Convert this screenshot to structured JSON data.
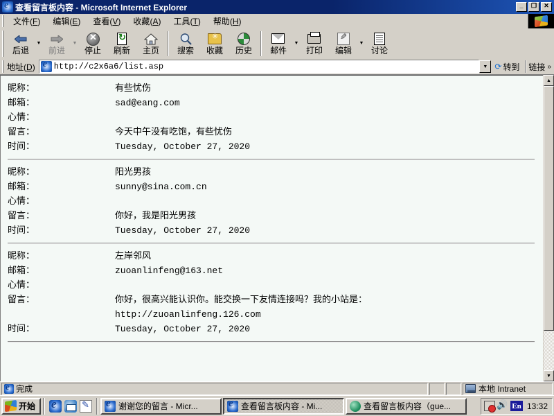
{
  "window": {
    "title": "查看留言板内容 - Microsoft Internet Explorer",
    "minimize_label": "_",
    "restore_label": "❐",
    "close_label": "✕"
  },
  "menubar": [
    {
      "label": "文件",
      "accel": "F"
    },
    {
      "label": "编辑",
      "accel": "E"
    },
    {
      "label": "查看",
      "accel": "V"
    },
    {
      "label": "收藏",
      "accel": "A"
    },
    {
      "label": "工具",
      "accel": "T"
    },
    {
      "label": "帮助",
      "accel": "H"
    }
  ],
  "toolbar": {
    "back": "后退",
    "forward": "前进",
    "stop": "停止",
    "refresh": "刷新",
    "home": "主页",
    "search": "搜索",
    "favorites": "收藏",
    "history": "历史",
    "mail": "邮件",
    "print": "打印",
    "edit": "编辑",
    "discuss": "讨论"
  },
  "address": {
    "label": "地址",
    "accel": "D",
    "url": "http://c2x6a6/list.asp",
    "go_label": "转到",
    "links_label": "链接",
    "links_chevron": "»"
  },
  "page": {
    "labels": {
      "nickname": "昵称：",
      "email": "邮箱：",
      "mood": "心情：",
      "message": "留言：",
      "time": "时间："
    },
    "entries": [
      {
        "nickname": "有些忧伤",
        "email": "sad@eang.com",
        "mood": "",
        "message_lines": [
          "今天中午没有吃饱，有些忧伤"
        ],
        "time": "Tuesday, October 27, 2020"
      },
      {
        "nickname": "阳光男孩",
        "email": "sunny@sina.com.cn",
        "mood": "",
        "message_lines": [
          "你好，我是阳光男孩"
        ],
        "time": "Tuesday, October 27, 2020"
      },
      {
        "nickname": "左岸邻风",
        "email": "zuoanlinfeng@163.net",
        "mood": "",
        "message_lines": [
          "你好，很高兴能认识你。能交换一下友情连接吗？我的小站是：",
          "http://zuoanlinfeng.126.com"
        ],
        "time": "Tuesday, October 27, 2020"
      }
    ]
  },
  "statusbar": {
    "status": "完成",
    "zone": "本地 Intranet"
  },
  "taskbar": {
    "start": "开始",
    "quick_launch": [
      "internet-explorer-icon",
      "outlook-express-icon",
      "notepad-icon"
    ],
    "tasks": [
      {
        "label": "谢谢您的留言 - Micr...",
        "icon": "ie",
        "active": false
      },
      {
        "label": "查看留言板内容 - Mi...",
        "icon": "ie",
        "active": true
      },
      {
        "label": "查看留言板内容（gue...",
        "icon": "globe",
        "active": false
      }
    ],
    "tray": {
      "ime": "En",
      "clock": "13:32"
    }
  },
  "colors": {
    "title_blue": "#0a246a",
    "face": "#d4d0c8",
    "page_bg": "#f4f9f6"
  }
}
